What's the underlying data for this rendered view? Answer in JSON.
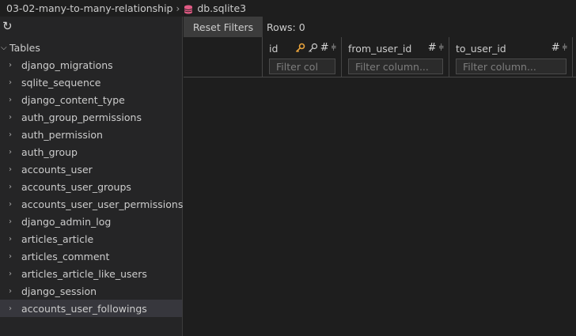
{
  "breadcrumb": {
    "folder": "03-02-many-to-many-relationship",
    "file": "db.sqlite3"
  },
  "sidebar": {
    "tables_label": "Tables",
    "tables": [
      "django_migrations",
      "sqlite_sequence",
      "django_content_type",
      "auth_group_permissions",
      "auth_permission",
      "auth_group",
      "accounts_user",
      "accounts_user_groups",
      "accounts_user_user_permissions",
      "django_admin_log",
      "articles_article",
      "articles_comment",
      "articles_article_like_users",
      "django_session",
      "accounts_user_followings"
    ],
    "selected": "accounts_user_followings"
  },
  "toolbar": {
    "reset_label": "Reset Filters",
    "rows_label": "Rows: 0"
  },
  "columns": [
    {
      "name": "id",
      "placeholder": "Filter col",
      "icons": [
        "primary-key-icon",
        "foreign-key-icon",
        "hash-icon",
        "pin-icon"
      ]
    },
    {
      "name": "from_user_id",
      "placeholder": "Filter column...",
      "icons": [
        "hash-icon",
        "pin-icon"
      ]
    },
    {
      "name": "to_user_id",
      "placeholder": "Filter column...",
      "icons": [
        "hash-icon",
        "pin-icon"
      ]
    }
  ],
  "colors": {
    "primary_key": "#e8a33c",
    "db_icon": "#e05a84"
  }
}
